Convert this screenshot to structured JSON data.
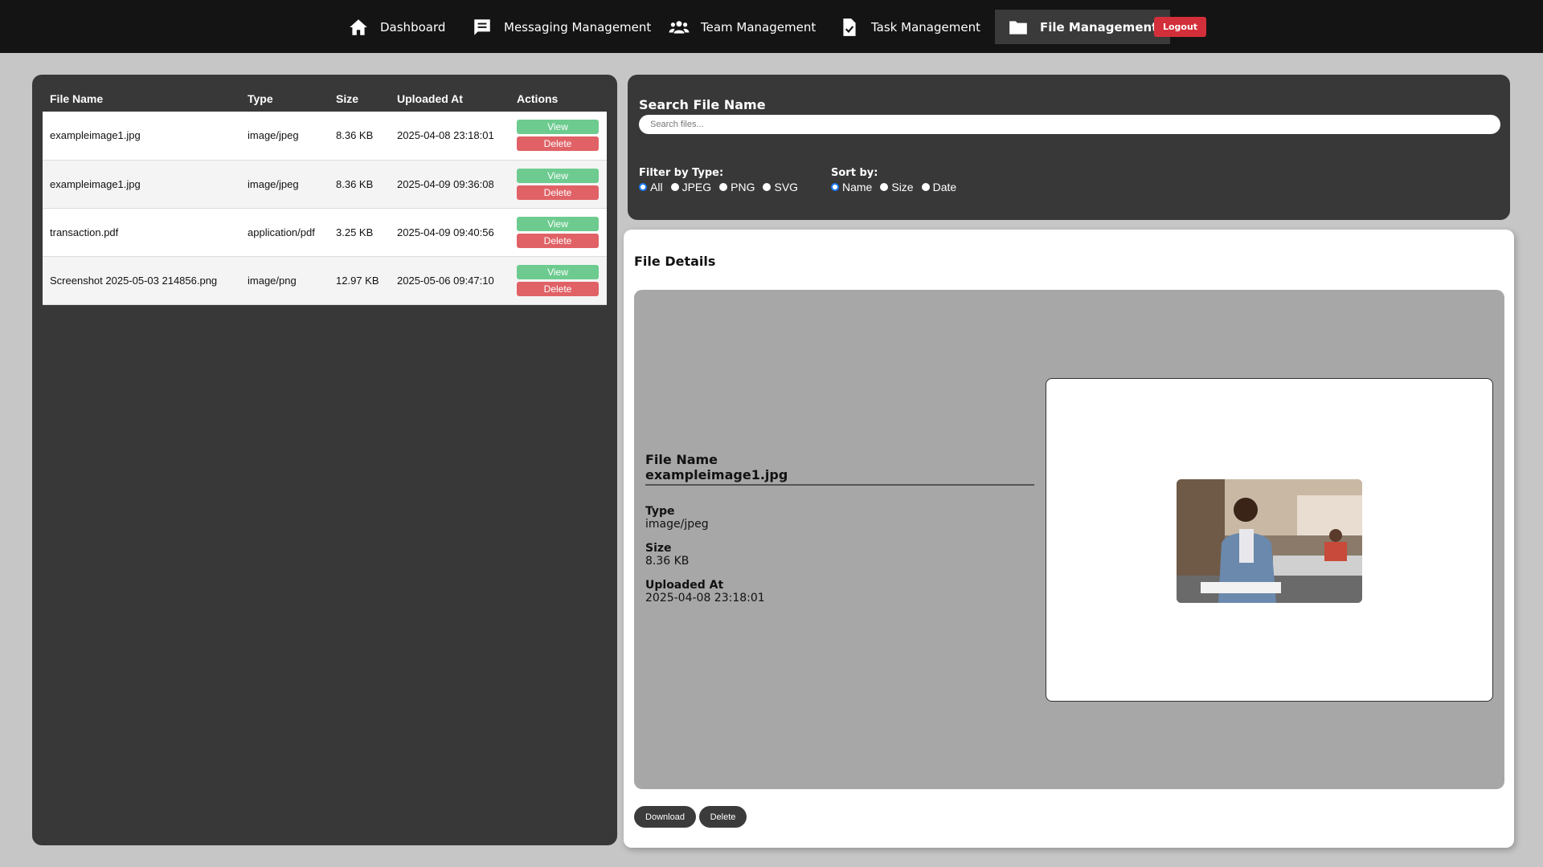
{
  "nav": {
    "items": [
      {
        "label": "Dashboard",
        "icon": "home-icon"
      },
      {
        "label": "Messaging Management",
        "icon": "message-icon"
      },
      {
        "label": "Team Management",
        "icon": "team-icon"
      },
      {
        "label": "Task Management",
        "icon": "task-icon"
      },
      {
        "label": "File Management",
        "icon": "folder-icon",
        "active": true
      }
    ],
    "logout_label": "Logout"
  },
  "table": {
    "headers": [
      "File Name",
      "Type",
      "Size",
      "Uploaded At",
      "Actions"
    ],
    "view_label": "View",
    "delete_label": "Delete",
    "rows": [
      {
        "name": "exampleimage1.jpg",
        "type": "image/jpeg",
        "size": "8.36 KB",
        "uploaded": "2025-04-08 23:18:01"
      },
      {
        "name": "exampleimage1.jpg",
        "type": "image/jpeg",
        "size": "8.36 KB",
        "uploaded": "2025-04-09 09:36:08"
      },
      {
        "name": "transaction.pdf",
        "type": "application/pdf",
        "size": "3.25 KB",
        "uploaded": "2025-04-09 09:40:56"
      },
      {
        "name": "Screenshot 2025-05-03 214856.png",
        "type": "image/png",
        "size": "12.97 KB",
        "uploaded": "2025-05-06 09:47:10"
      }
    ]
  },
  "search": {
    "title": "Search File Name",
    "placeholder": "Search files...",
    "filter_label": "Filter by Type:",
    "filter_options": [
      "All",
      "JPEG",
      "PNG",
      "SVG"
    ],
    "filter_selected": "All",
    "sort_label": "Sort by:",
    "sort_options": [
      "Name",
      "Size",
      "Date"
    ],
    "sort_selected": "Name"
  },
  "details": {
    "title": "File Details",
    "name_label": "File Name",
    "name_value": "exampleimage1.jpg",
    "type_label": "Type",
    "type_value": "image/jpeg",
    "size_label": "Size",
    "size_value": "8.36 KB",
    "uploaded_label": "Uploaded At",
    "uploaded_value": "2025-04-08 23:18:01",
    "download_label": "Download",
    "delete_label": "Delete"
  },
  "colors": {
    "accent": "#1e7bf5",
    "view_button": "#6dcb8f",
    "delete_button": "#e06266",
    "logout_button": "#d32f3a"
  }
}
